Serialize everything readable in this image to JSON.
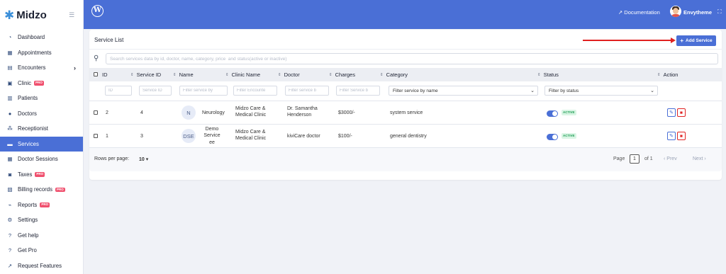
{
  "brand": {
    "name": "Midzo"
  },
  "sidebar": {
    "items": [
      {
        "label": "Dashboard",
        "icon": "dashboard-icon"
      },
      {
        "label": "Appointments",
        "icon": "calendar-icon"
      },
      {
        "label": "Encounters",
        "icon": "clipboard-icon"
      },
      {
        "label": "Clinic",
        "icon": "hospital-icon",
        "badge": "PRO"
      },
      {
        "label": "Patients",
        "icon": "patients-icon"
      },
      {
        "label": "Doctors",
        "icon": "doctor-icon"
      },
      {
        "label": "Receptionist",
        "icon": "users-icon"
      },
      {
        "label": "Services",
        "icon": "services-icon",
        "active": true
      },
      {
        "label": "Doctor Sessions",
        "icon": "calendar-icon"
      },
      {
        "label": "Taxes",
        "icon": "tax-icon",
        "badge": "PRO"
      },
      {
        "label": "Billing records",
        "icon": "billing-icon",
        "badge": "PRO"
      },
      {
        "label": "Reports",
        "icon": "chart-icon",
        "badge": "PRO"
      },
      {
        "label": "Settings",
        "icon": "settings-icon"
      },
      {
        "label": "Get help",
        "icon": "help-icon"
      },
      {
        "label": "Get Pro",
        "icon": "help-icon"
      },
      {
        "label": "Request Features",
        "icon": "external-link-icon"
      }
    ]
  },
  "topbar": {
    "documentation": "Documentation",
    "user_name": "Envytheme"
  },
  "card": {
    "title": "Service List",
    "add_button": "Add Service",
    "search_placeholder": "Search services data by id, doctor, name, category, price  and status(active or inactive)"
  },
  "table": {
    "headers": {
      "id": "ID",
      "service_id": "Service ID",
      "name": "Name",
      "clinic_name": "Clinic Name",
      "doctor": "Doctor",
      "charges": "Charges",
      "category": "Category",
      "status": "Status",
      "action": "Action"
    },
    "filters": {
      "id": "ID",
      "service_id": "Service ID",
      "name": "Filter service by",
      "clinic_name": "Filter Encounte",
      "doctor": "Filter service b",
      "charges": "Filter Service b",
      "category": "Filter service by name",
      "status": "Filter by status"
    },
    "rows": [
      {
        "id": "2",
        "service_id": "4",
        "initials": "N",
        "name": "Neurology",
        "clinic": [
          "Midzo Care &",
          "Medical Clinic"
        ],
        "doctor": [
          "Dr. Samantha",
          "Henderson"
        ],
        "charges": "$3000/-",
        "category": "system service",
        "status": "ACTIVE"
      },
      {
        "id": "1",
        "service_id": "3",
        "initials": "DSE",
        "name": [
          "Demo",
          "Service",
          "ee"
        ],
        "clinic": [
          "Midzo Care &",
          "Medical Clinic"
        ],
        "doctor": [
          "kiviCare doctor"
        ],
        "charges": "$100/-",
        "category": "general dentistry",
        "status": "ACTIVE"
      }
    ]
  },
  "footer": {
    "rows_per_page_label": "Rows per page:",
    "rows_per_page_value": "10",
    "page_label": "Page",
    "page_value": "1",
    "of_label": "of 1",
    "prev_label": "Prev",
    "next_label": "Next"
  },
  "colors": {
    "accent": "#4a6fd6",
    "danger": "#e02424",
    "success": "#1f9d55",
    "pro": "#f0506e"
  }
}
